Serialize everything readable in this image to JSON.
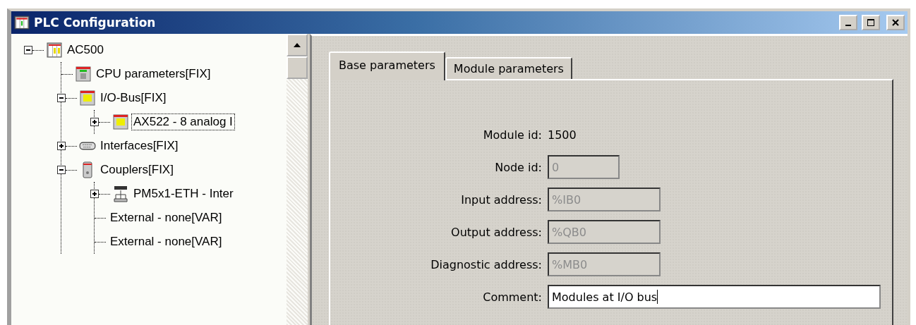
{
  "window": {
    "title": "PLC Configuration"
  },
  "tree": [
    {
      "label": "AC500",
      "kind": "rack",
      "expanded": true,
      "selected": false,
      "children": [
        {
          "label": "CPU parameters[FIX]",
          "kind": "cpu",
          "selected": false
        },
        {
          "label": "I/O-Bus[FIX]",
          "kind": "io",
          "expanded": true,
          "selected": false,
          "children": [
            {
              "label": "AX522 - 8 analog I",
              "kind": "module",
              "expanded": false,
              "selected": true
            }
          ]
        },
        {
          "label": "Interfaces[FIX]",
          "kind": "interface",
          "expanded": false,
          "selected": false
        },
        {
          "label": "Couplers[FIX]",
          "kind": "coupler",
          "expanded": true,
          "selected": false,
          "children": [
            {
              "label": "PM5x1-ETH - Inter",
              "kind": "ethernet",
              "expanded": false,
              "selected": false
            },
            {
              "label": "External - none[VAR]",
              "selected": false
            },
            {
              "label": "External - none[VAR]",
              "selected": false
            }
          ]
        }
      ]
    }
  ],
  "tabs": [
    {
      "label": "Base parameters",
      "selected": true
    },
    {
      "label": "Module parameters",
      "selected": false
    }
  ],
  "fields": [
    {
      "label": "Module id:",
      "kind": "text",
      "value": "1500"
    },
    {
      "label": "Node id:",
      "kind": "short",
      "value": "0",
      "disabled": true
    },
    {
      "label": "Input address:",
      "kind": "medium",
      "value": "%IB0",
      "disabled": true
    },
    {
      "label": "Output address:",
      "kind": "medium",
      "value": "%QB0",
      "disabled": true
    },
    {
      "label": "Diagnostic address:",
      "kind": "medium",
      "value": "%MB0",
      "disabled": true
    },
    {
      "label": "Comment:",
      "kind": "long",
      "value": "Modules at I/O bus",
      "disabled": false
    }
  ]
}
